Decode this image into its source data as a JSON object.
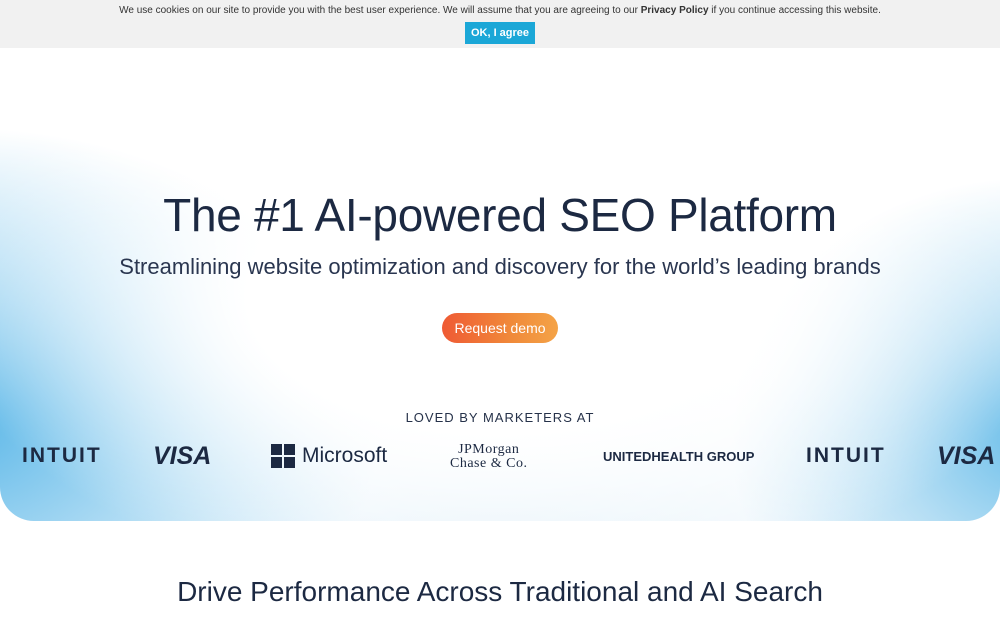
{
  "cookie_banner": {
    "text_before": "We use cookies on our site to provide you with the best user experience. We will assume that you are agreeing to our ",
    "link_text": "Privacy Policy",
    "text_after": " if you continue accessing this website.",
    "button_label": "OK, I agree",
    "button_color": "#1ba7d7"
  },
  "hero": {
    "title": "The #1 AI-powered SEO Platform",
    "subtitle": "Streamlining website optimization and discovery for the world’s leading brands",
    "cta_label": "Request demo",
    "cta_gradient": [
      "#ef5a34",
      "#f4a347"
    ],
    "loved_label": "LOVED BY MARKETERS AT",
    "logos": {
      "intuit_1": "INTUIT",
      "visa_1": "VISA",
      "microsoft": "Microsoft",
      "jpmorgan_line1": "JPMorgan",
      "jpmorgan_line2": "Chase & Co.",
      "unitedhealth": "UNITEDHEALTH GROUP",
      "intuit_2": "INTUIT",
      "visa_2": "VISA"
    }
  },
  "section": {
    "title": "Drive Performance Across Traditional and AI Search"
  }
}
